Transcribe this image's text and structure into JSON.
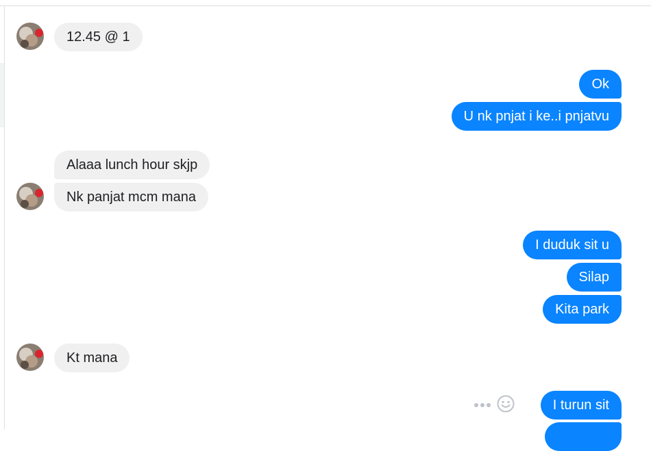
{
  "chat": {
    "messages": [
      {
        "direction": "incoming",
        "text": "12.45 @ 1"
      },
      {
        "direction": "outgoing",
        "text": "Ok"
      },
      {
        "direction": "outgoing",
        "text": "U nk pnjat i ke..i pnjatvu"
      },
      {
        "direction": "incoming",
        "text": "Alaaa lunch hour skjp"
      },
      {
        "direction": "incoming",
        "text": "Nk panjat mcm mana"
      },
      {
        "direction": "outgoing",
        "text": "I duduk sit u"
      },
      {
        "direction": "outgoing",
        "text": "Silap"
      },
      {
        "direction": "outgoing",
        "text": "Kita park"
      },
      {
        "direction": "incoming",
        "text": "Kt mana"
      },
      {
        "direction": "outgoing",
        "text": "I turun sit"
      },
      {
        "direction": "outgoing",
        "text": ""
      }
    ],
    "icons": {
      "more": "more-options-icon",
      "react": "emoji-smile-icon"
    }
  },
  "colors": {
    "outgoing_bubble": "#0a84ff",
    "incoming_bubble": "#f1f0f0",
    "outgoing_text": "#ffffff",
    "incoming_text": "#1c1e21"
  }
}
